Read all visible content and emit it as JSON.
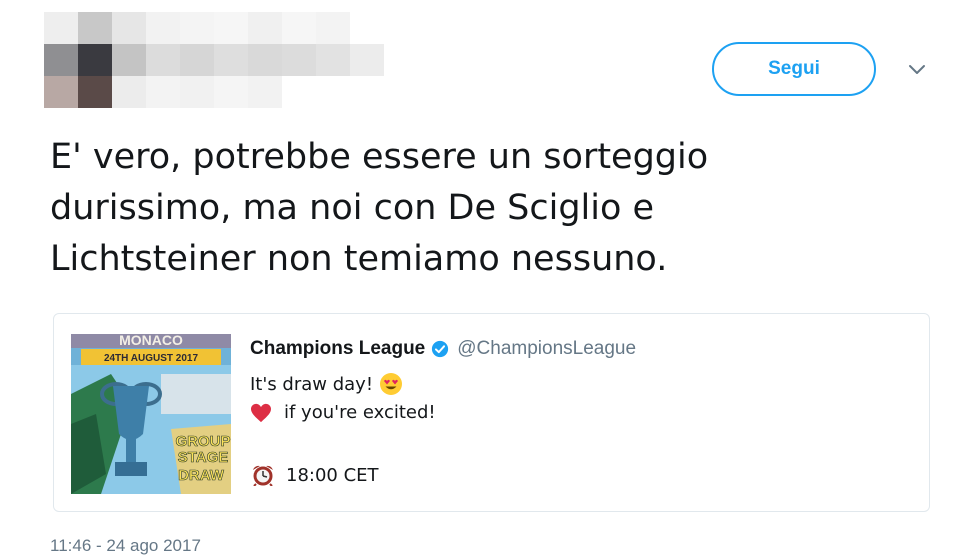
{
  "header": {
    "follow_label": "Segui"
  },
  "tweet": {
    "text": "E' vero, potrebbe essere un sorteggio durissimo, ma noi con De Sciglio e Lichtsteiner non temiamo nessuno.",
    "timestamp": "11:46 - 24 ago 2017"
  },
  "quoted": {
    "name": "Champions League",
    "handle": "@ChampionsLeague",
    "line1": "It's draw day!",
    "line2": "if you're excited!",
    "line3": "18:00 CET",
    "thumb_top_text": "MONACO",
    "thumb_date": "24TH AUGUST 2017",
    "thumb_caption_1": "GROUP",
    "thumb_caption_2": "STAGE",
    "thumb_caption_3": "DRAW"
  },
  "icons": {
    "follow_menu": "chevron-down-icon",
    "verified": "verified-badge-icon",
    "emoji_1": "heart-eyes-emoji-icon",
    "emoji_2": "red-heart-icon",
    "emoji_3": "alarm-clock-icon"
  },
  "colors": {
    "accent": "#1da1f2",
    "text": "#14171a",
    "secondary": "#657786",
    "border": "#e1e8ed"
  }
}
